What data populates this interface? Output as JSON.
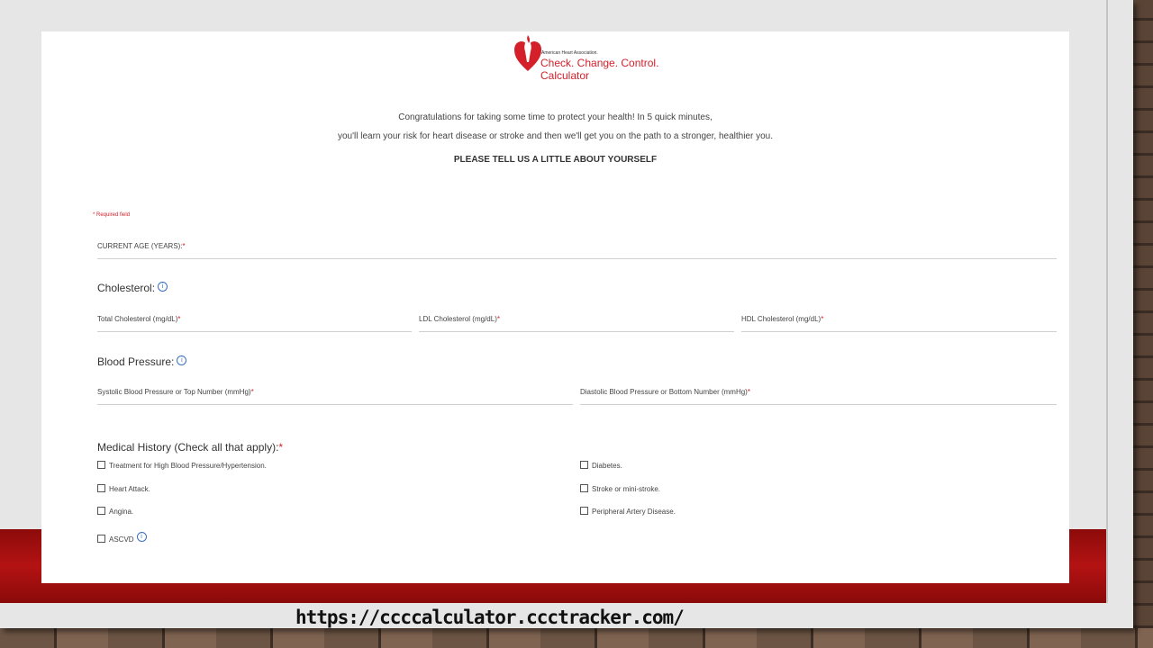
{
  "logo": {
    "org": "American Heart Association.",
    "title": "Check. Change. Control.",
    "subtitle": "Calculator"
  },
  "intro": {
    "line1": "Congratulations for taking some time to protect your health! In 5 quick minutes,",
    "line2": "you'll learn your risk for heart disease or stroke and then we'll get you on the path to a stronger, healthier you.",
    "call": "PLEASE TELL US A LITTLE ABOUT YOURSELF"
  },
  "required_note": "* Required field",
  "fields": {
    "age": "CURRENT AGE (YEARS):",
    "cholesterol_section": "Cholesterol:",
    "total_chol": "Total Cholesterol (mg/dL)",
    "ldl": "LDL Cholesterol (mg/dL)",
    "hdl": "HDL Cholesterol (mg/dL)",
    "bp_section": "Blood Pressure:",
    "systolic": "Systolic Blood Pressure or Top Number (mmHg)",
    "diastolic": "Diastolic Blood Pressure or Bottom Number (mmHg)"
  },
  "history": {
    "label": "Medical History (Check all that apply):",
    "items": [
      "Treatment for High Blood Pressure/Hypertension.",
      "Diabetes.",
      "Heart Attack.",
      "Stroke or mini-stroke.",
      "Angina.",
      "Peripheral Artery Disease.",
      "ASCVD"
    ]
  },
  "required_star": "*",
  "info_glyph": "i",
  "url": "https://ccccalculator.ccctracker.com/",
  "colors": {
    "accent_red": "#d4202a",
    "band_red": "#b41212",
    "info_blue": "#3a6fc0"
  }
}
